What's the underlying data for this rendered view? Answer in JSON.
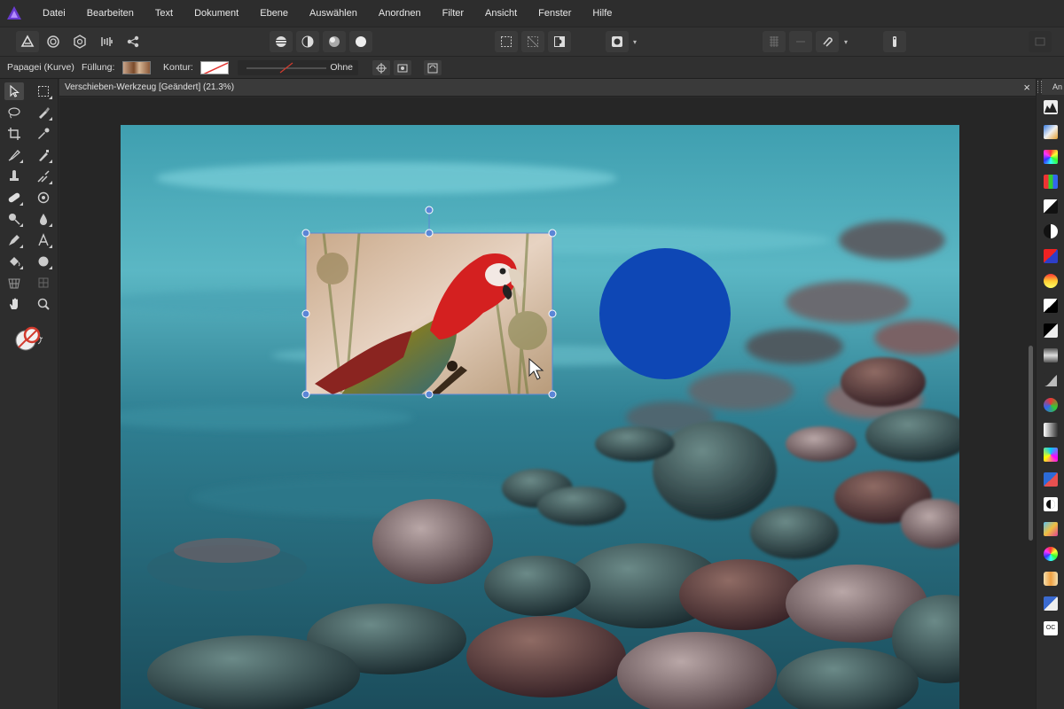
{
  "app": {
    "logo": "affinity-photo-logo"
  },
  "menu": [
    "Datei",
    "Bearbeiten",
    "Text",
    "Dokument",
    "Ebene",
    "Auswählen",
    "Anordnen",
    "Filter",
    "Ansicht",
    "Fenster",
    "Hilfe"
  ],
  "contextbar": {
    "object_name": "Papagei (Kurve)",
    "fill_label": "Füllung:",
    "stroke_label": "Kontur:",
    "stroke_width_value": "Ohne"
  },
  "document": {
    "tab_title": "Verschieben-Werkzeug [Geändert] (21.3%)",
    "close_glyph": "×"
  },
  "right_panel": {
    "tab_label": "An"
  },
  "colors": {
    "accent": "#6a3bd1",
    "selection": "#5b86d6",
    "circle": "#0e47b5",
    "menubar": "#2d2d2d",
    "toolbar": "#323232"
  }
}
